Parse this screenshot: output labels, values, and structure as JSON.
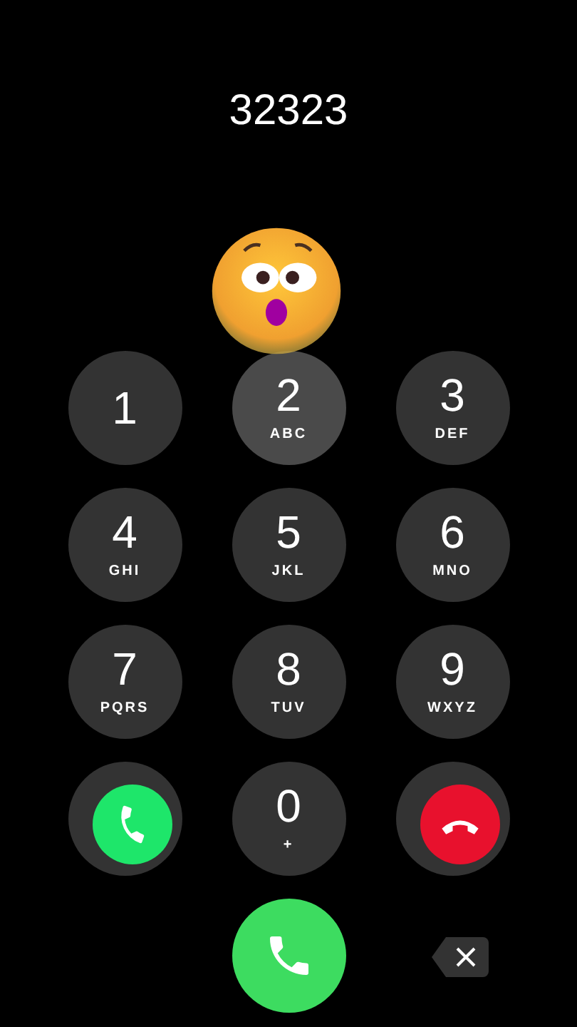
{
  "number": "32323",
  "keys": [
    {
      "kind": "digit",
      "digit": "1",
      "pressed": false
    },
    {
      "kind": "digit",
      "digit": "2",
      "letters": "ABC",
      "pressed": true
    },
    {
      "kind": "digit",
      "digit": "3",
      "letters": "DEF",
      "pressed": false
    },
    {
      "kind": "digit",
      "digit": "4",
      "letters": "GHI",
      "pressed": false
    },
    {
      "kind": "digit",
      "digit": "5",
      "letters": "JKL",
      "pressed": false
    },
    {
      "kind": "digit",
      "digit": "6",
      "letters": "MNO",
      "pressed": false
    },
    {
      "kind": "digit",
      "digit": "7",
      "letters": "PQRS",
      "pressed": false
    },
    {
      "kind": "digit",
      "digit": "8",
      "letters": "TUV",
      "pressed": false
    },
    {
      "kind": "digit",
      "digit": "9",
      "letters": "WXYZ",
      "pressed": false
    },
    {
      "kind": "answer",
      "pressed": false
    },
    {
      "kind": "digit",
      "digit": "0",
      "letters": "+",
      "pressed": false
    },
    {
      "kind": "decline",
      "pressed": false
    }
  ]
}
